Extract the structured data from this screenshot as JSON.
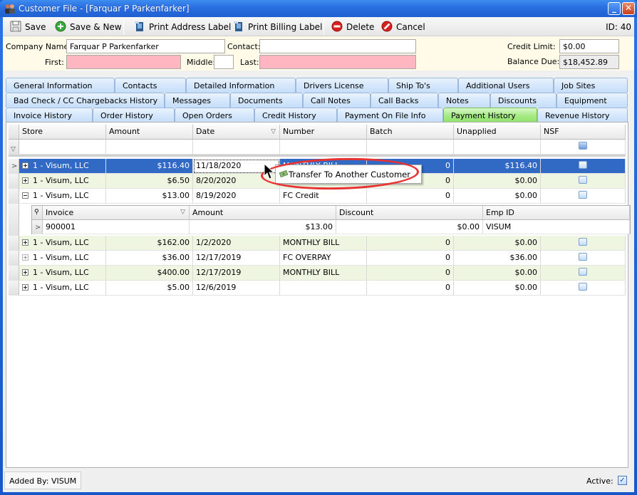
{
  "window": {
    "title": "Customer File - [Farquar P Parkenfarker]",
    "minimize": "_",
    "close": "✕"
  },
  "toolbar": {
    "save": "Save",
    "save_new": "Save & New",
    "print_address": "Print Address Label",
    "print_billing": "Print Billing Label",
    "delete": "Delete",
    "cancel": "Cancel",
    "id": "ID: 40"
  },
  "header": {
    "company_label": "Company Name:",
    "company_value": "Farquar P Parkenfarker",
    "contact_label": "Contact:",
    "contact_value": "",
    "first_label": "First:",
    "first_value": "",
    "middle_label": "Middle:",
    "middle_value": "",
    "last_label": "Last:",
    "last_value": "",
    "credit_limit_label": "Credit Limit:",
    "credit_limit_value": "$0.00",
    "balance_due_label": "Balance Due:",
    "balance_due_value": "$18,452.89"
  },
  "tabs": {
    "row1": [
      "General Information",
      "Contacts",
      "Detailed Information",
      "Drivers License",
      "Ship To's",
      "Additional Users",
      "Job Sites"
    ],
    "row2": [
      "Bad Check / CC Chargebacks History",
      "Messages",
      "Documents",
      "Call Notes",
      "Call Backs",
      "Notes",
      "Discounts",
      "Equipment"
    ],
    "row3": [
      "Invoice History",
      "Order History",
      "Open Orders",
      "Credit History",
      "Payment On File Info",
      "Payment History",
      "Revenue History"
    ],
    "active": "Payment History"
  },
  "grid": {
    "columns": [
      "Store",
      "Amount",
      "Date",
      "Number",
      "Batch",
      "Unapplied",
      "NSF"
    ],
    "rows": [
      {
        "store": "1 - Visum, LLC",
        "amount": "$116.40",
        "date": "11/18/2020",
        "number": "MONTHLY BILL",
        "batch": "0",
        "unapplied": "$116.40",
        "nsf": false,
        "expanded": false,
        "selected": true
      },
      {
        "store": "1 - Visum, LLC",
        "amount": "$6.50",
        "date": "8/20/2020",
        "number": "",
        "batch": "0",
        "unapplied": "$0.00",
        "nsf": false,
        "expanded": false
      },
      {
        "store": "1 - Visum, LLC",
        "amount": "$13.00",
        "date": "8/19/2020",
        "number": "FC Credit",
        "batch": "0",
        "unapplied": "$0.00",
        "nsf": false,
        "expanded": true
      },
      {
        "store": "1 - Visum, LLC",
        "amount": "$162.00",
        "date": "1/2/2020",
        "number": "MONTHLY BILL",
        "batch": "0",
        "unapplied": "$0.00",
        "nsf": false,
        "expanded": false
      },
      {
        "store": "1 - Visum, LLC",
        "amount": "$36.00",
        "date": "12/17/2019",
        "number": "FC OVERPAY",
        "batch": "0",
        "unapplied": "$36.00",
        "nsf": false,
        "expanded": false
      },
      {
        "store": "1 - Visum, LLC",
        "amount": "$400.00",
        "date": "12/17/2019",
        "number": "MONTHLY BILL",
        "batch": "0",
        "unapplied": "$0.00",
        "nsf": false,
        "expanded": false
      },
      {
        "store": "1 - Visum, LLC",
        "amount": "$5.00",
        "date": "12/6/2019",
        "number": "",
        "batch": "0",
        "unapplied": "$0.00",
        "nsf": false,
        "expanded": false
      }
    ],
    "detail": {
      "columns": [
        "Invoice",
        "Amount",
        "Discount",
        "Emp ID"
      ],
      "rows": [
        {
          "invoice": "900001",
          "amount": "$13.00",
          "discount": "$0.00",
          "emp_id": "VISUM"
        }
      ]
    }
  },
  "context_menu": {
    "items": [
      "Transfer To Another Customer"
    ]
  },
  "status": {
    "added_by": "Added By: VISUM",
    "active_label": "Active:",
    "active_checked": true
  }
}
